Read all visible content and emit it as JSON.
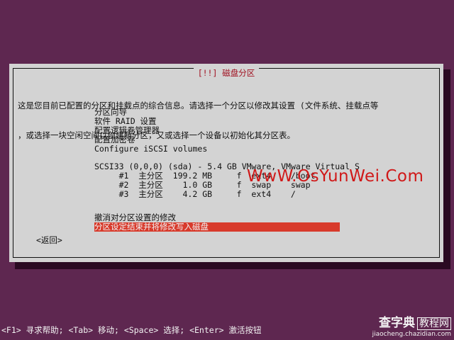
{
  "dialog": {
    "title": "[!!] 磁盘分区",
    "intro_line1": "这是您目前已配置的分区和挂载点的综合信息。请选择一个分区以修改其设置 (文件系统、挂载点等",
    "intro_line2": "，或选择一块空闲空间以创建新分区，又或选择一个设备以初始化其分区表。",
    "menu": {
      "guided": "分区向导",
      "raid": "软件 RAID 设置",
      "lvm": "配置逻辑卷管理器",
      "crypto": "配置加密卷",
      "iscsi": "Configure iSCSI volumes",
      "disk": "SCSI33 (0,0,0) (sda) - 5.4 GB VMware, VMware Virtual S",
      "partitions": [
        {
          "num": "#1",
          "type": "主分区",
          "size": "199.2 MB",
          "flag": "f",
          "fs": "ext4",
          "mount": "/boot"
        },
        {
          "num": "#2",
          "type": "主分区",
          "size": "1.0 GB",
          "flag": "f",
          "fs": "swap",
          "mount": "swap"
        },
        {
          "num": "#3",
          "type": "主分区",
          "size": "4.2 GB",
          "flag": "f",
          "fs": "ext4",
          "mount": "/"
        }
      ],
      "undo": "撤消对分区设置的修改",
      "finish": "分区设定结束并将修改写入磁盘"
    },
    "back": "<返回>"
  },
  "footer": "<F1> 寻求帮助; <Tab> 移动; <Space> 选择; <Enter> 激活按钮",
  "watermark": "WwW.OsYunWei.Com",
  "logo": {
    "top": "查字典",
    "boxed": "教程网",
    "url": "jiaocheng.chazidian.com"
  },
  "colors": {
    "background": "#5e2750",
    "dialog": "#d3d3d3",
    "selection": "#d83a2b",
    "title_text": "#a01020"
  }
}
